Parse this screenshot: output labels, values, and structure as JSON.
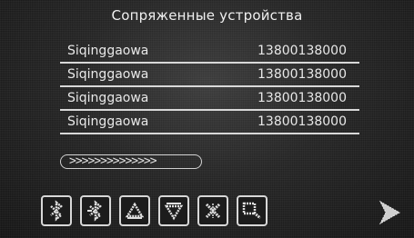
{
  "header": {
    "title": "Сопряженные устройства"
  },
  "devices": [
    {
      "name": "Siqinggaowa",
      "number": "13800138000"
    },
    {
      "name": "Siqinggaowa",
      "number": "13800138000"
    },
    {
      "name": "Siqinggaowa",
      "number": "13800138000"
    },
    {
      "name": "Siqinggaowa",
      "number": "13800138000"
    }
  ],
  "progress": {
    "text": ">>>>>>>>>>>>>>"
  },
  "toolbar": {
    "buttons": [
      {
        "icon": "bluetooth-icon"
      },
      {
        "icon": "bluetooth-off-icon"
      },
      {
        "icon": "scroll-up-icon"
      },
      {
        "icon": "scroll-down-icon"
      },
      {
        "icon": "delete-icon"
      },
      {
        "icon": "search-icon"
      }
    ],
    "next_icon": "next-arrow-icon"
  },
  "colors": {
    "text": "#e8e8e8",
    "divider": "#d8d8d8",
    "background": "#1a1a1a"
  }
}
